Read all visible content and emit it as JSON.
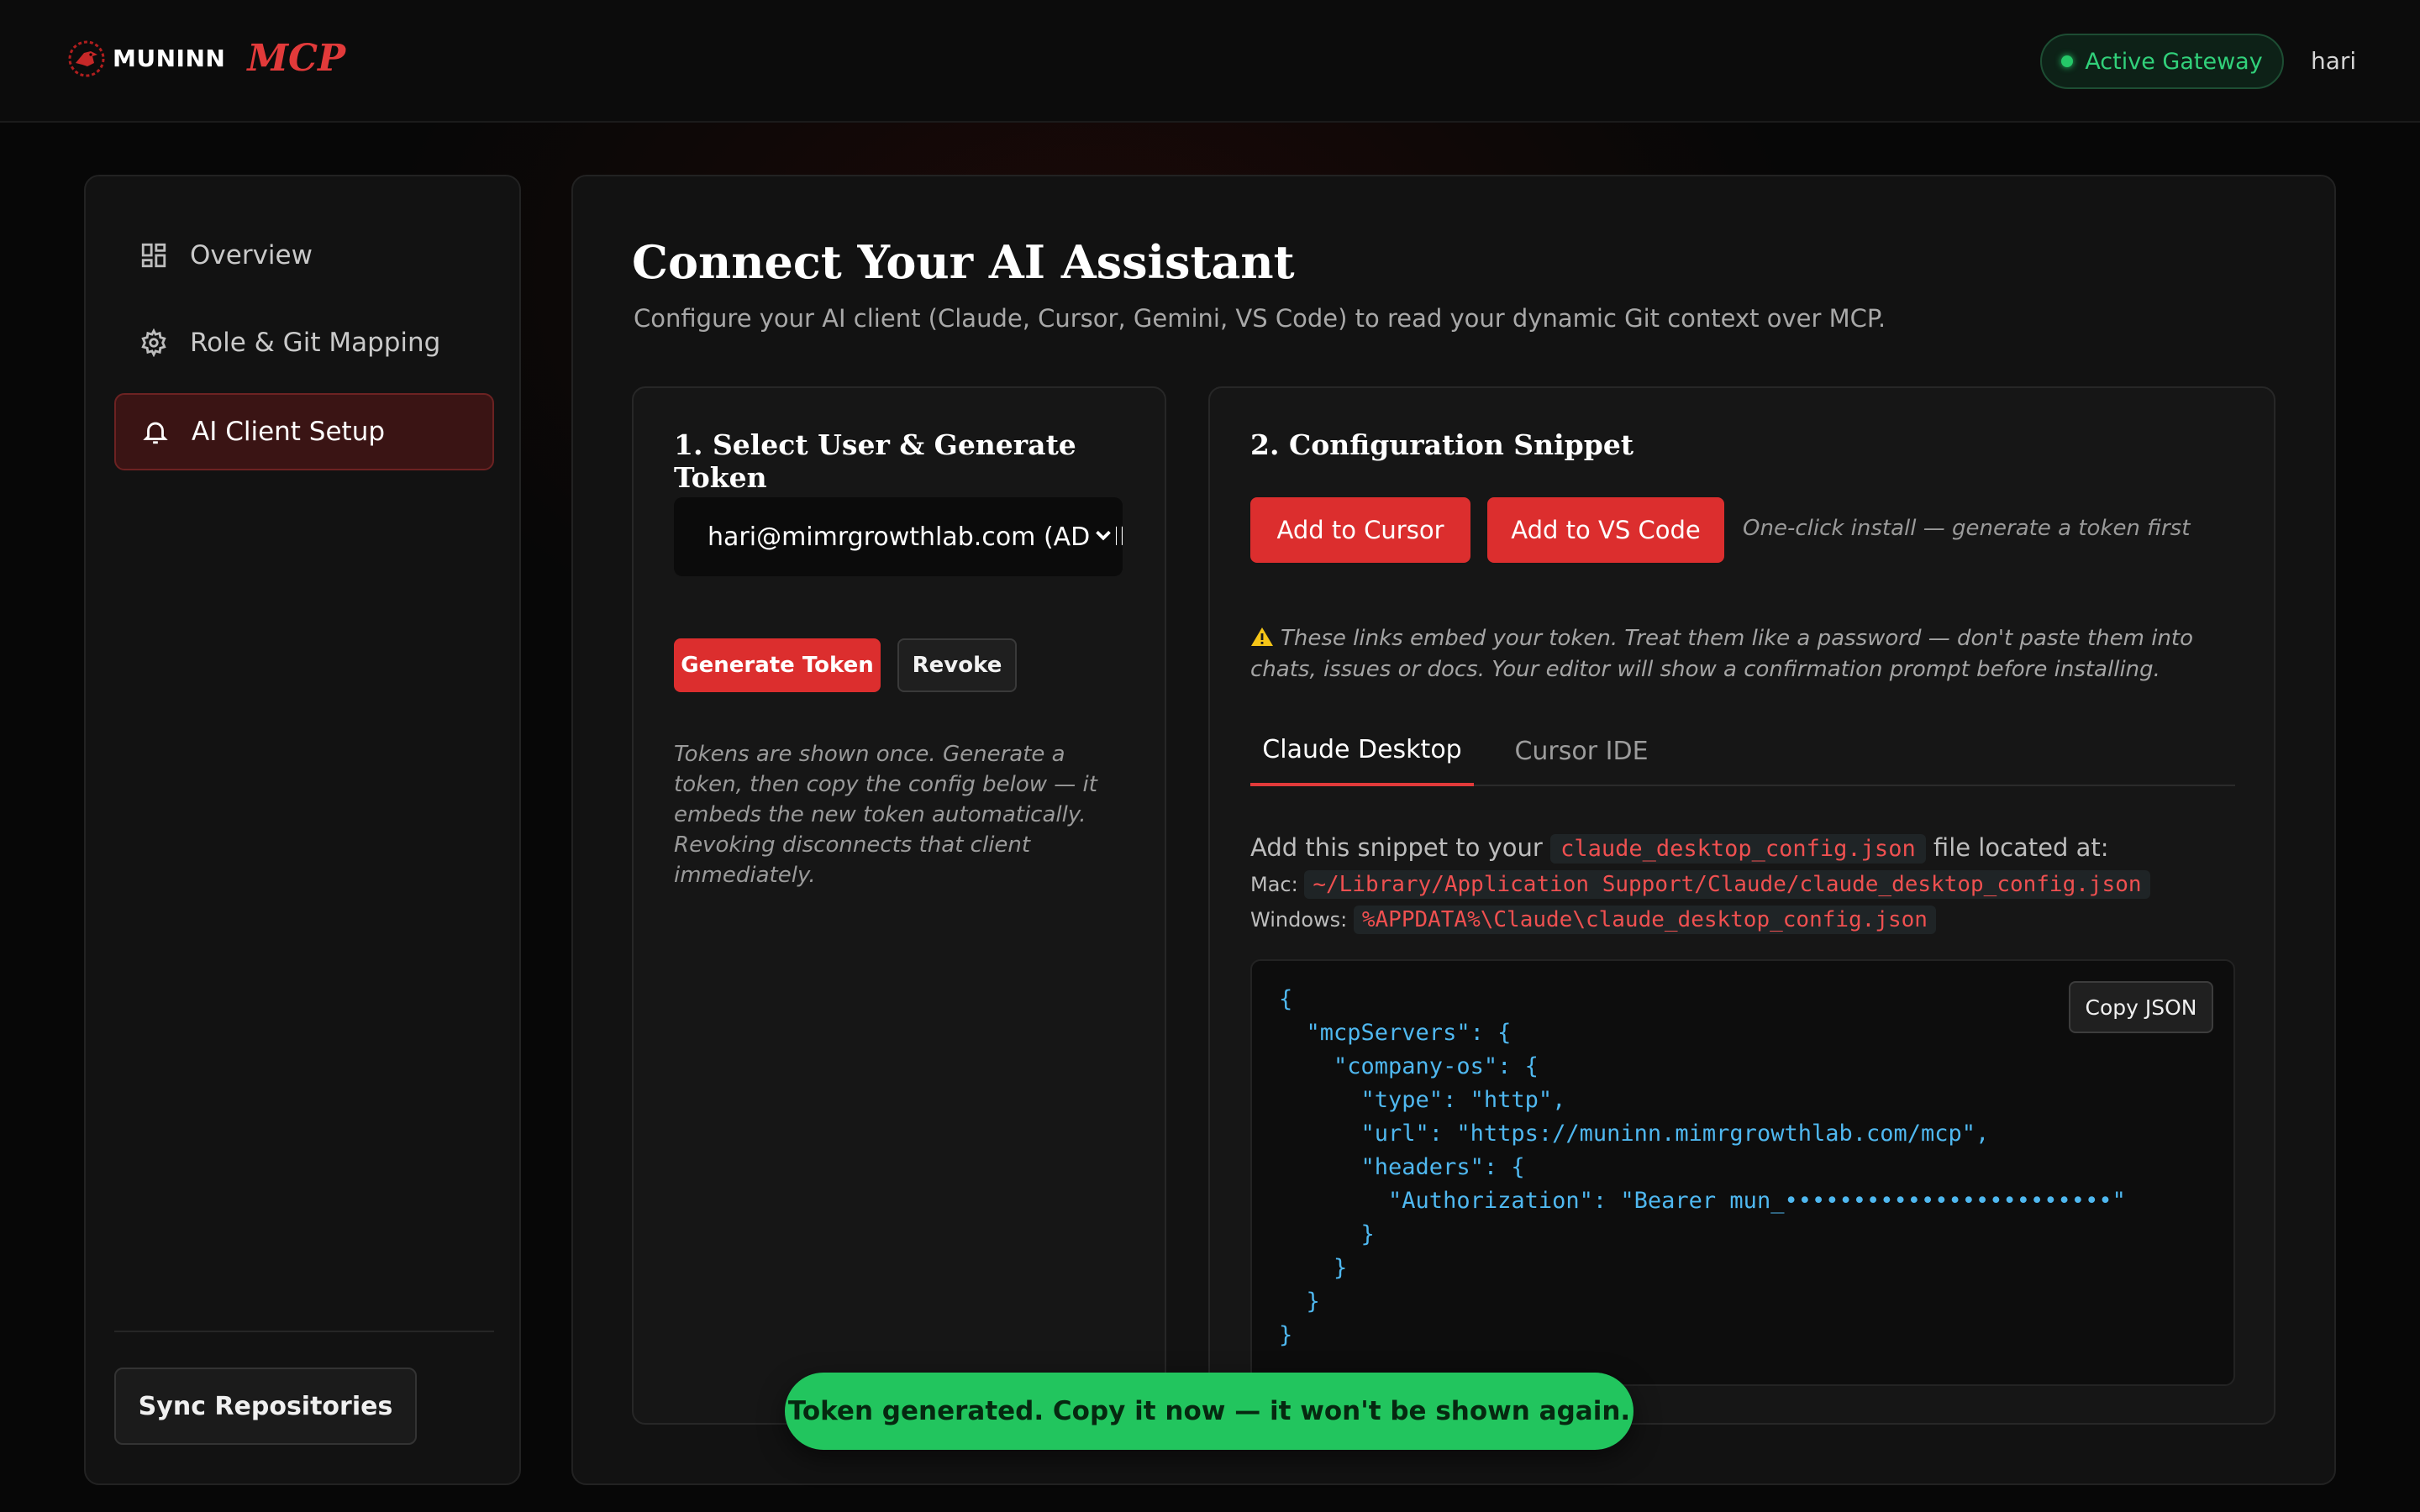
{
  "brand": {
    "name": "MUNINN",
    "product": "MCP"
  },
  "header": {
    "status_label": "Active Gateway",
    "user": "hari"
  },
  "sidebar": {
    "items": [
      {
        "label": "Overview",
        "icon": "grid-icon"
      },
      {
        "label": "Role & Git Mapping",
        "icon": "gear-icon"
      },
      {
        "label": "AI Client Setup",
        "icon": "bell-icon",
        "active": true
      }
    ],
    "sync_label": "Sync Repositories"
  },
  "main": {
    "title": "Connect Your AI Assistant",
    "subtitle": "Configure your AI client (Claude, Cursor, Gemini, VS Code) to read your dynamic Git context over MCP."
  },
  "token_card": {
    "title": "1. Select User & Generate Token",
    "selected_user": "hari@mimrgrowthlab.com (ADMIN)",
    "generate_label": "Generate Token",
    "revoke_label": "Revoke",
    "helper": "Tokens are shown once. Generate a token, then copy the config below — it embeds the new token automatically. Revoking disconnects that client immediately."
  },
  "config_card": {
    "title": "2. Configuration Snippet",
    "add_cursor_label": "Add to Cursor",
    "add_vscode_label": "Add to VS Code",
    "oneclick_note": "One-click install — generate a token first",
    "warning": "These links embed your token. Treat them like a password — don't paste them into chats, issues or docs. Your editor will show a confirmation prompt before installing.",
    "tabs": [
      "Claude Desktop",
      "Cursor IDE"
    ],
    "snippet_intro": "Add this snippet to your",
    "snippet_file": "claude_desktop_config.json",
    "snippet_suffix": "file located at:",
    "mac_label": "Mac:",
    "mac_path": "~/Library/Application Support/Claude/claude_desktop_config.json",
    "windows_label": "Windows:",
    "windows_path": "%APPDATA%\\Claude\\claude_desktop_config.json",
    "copy_label": "Copy JSON",
    "code_lines": [
      "{",
      "  \"mcpServers\": {",
      "    \"company-os\": {",
      "      \"type\": \"http\",",
      "      \"url\": \"https://muninn.mimrgrowthlab.com/mcp\",",
      "      \"headers\": {",
      "        \"Authorization\": \"Bearer mun_••••••••••••••••••••••••\"",
      "      }",
      "    }",
      "  }",
      "}"
    ]
  },
  "toast": {
    "message": "Token generated. Copy it now — it won't be shown again."
  },
  "colors": {
    "accent": "#dc2e2e",
    "success": "#22c55e",
    "code": "#4fb8f0"
  }
}
